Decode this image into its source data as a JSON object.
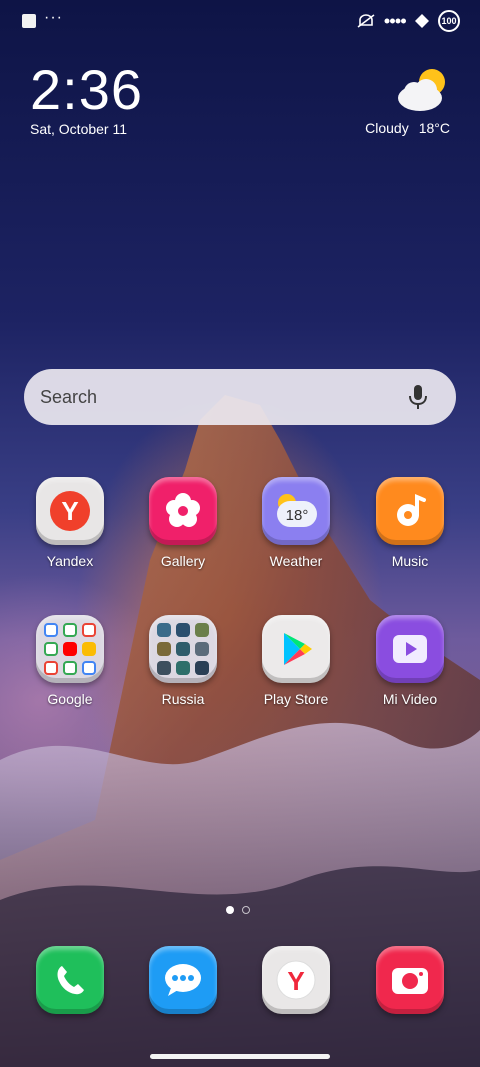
{
  "status_bar": {
    "dots": "···",
    "battery": "100",
    "icons": [
      "notification-square-icon",
      "silent-alarm-icon",
      "signal-dots-icon",
      "data-diamond-icon",
      "battery-icon"
    ]
  },
  "clock": {
    "time": "2:36",
    "date": "Sat, October 11"
  },
  "weather": {
    "condition": "Cloudy",
    "temperature": "18°C",
    "icon": "cloudy-sun-icon"
  },
  "search": {
    "placeholder": "Search",
    "icon": "microphone-icon"
  },
  "apps": [
    {
      "label": "Yandex",
      "icon": "yandex-icon",
      "color": "#e8e6e6"
    },
    {
      "label": "Gallery",
      "icon": "gallery-flower-icon",
      "color": "#f0206a"
    },
    {
      "label": "Weather",
      "icon": "weather-icon",
      "color": "#8b7ff0",
      "badge": "18°"
    },
    {
      "label": "Music",
      "icon": "music-note-icon",
      "color": "#ff8a1e"
    },
    {
      "label": "Google",
      "icon": "folder-icon",
      "color": "#dcd8e2"
    },
    {
      "label": "Russia",
      "icon": "folder-icon",
      "color": "#dcd8e2"
    },
    {
      "label": "Play Store",
      "icon": "play-store-icon",
      "color": "#eceaea"
    },
    {
      "label": "Mi Video",
      "icon": "video-play-icon",
      "color": "#8a4de0"
    }
  ],
  "dock": [
    {
      "name": "phone",
      "icon": "phone-icon",
      "color": "#1fbf5b"
    },
    {
      "name": "messages",
      "icon": "message-bubble-icon",
      "color": "#1e9cf5"
    },
    {
      "name": "browser",
      "icon": "yandex-browser-icon",
      "color": "#e9e7e7"
    },
    {
      "name": "camera",
      "icon": "camera-icon",
      "color": "#f0284d"
    }
  ],
  "page_indicator": {
    "pages": 2,
    "current": 1
  }
}
